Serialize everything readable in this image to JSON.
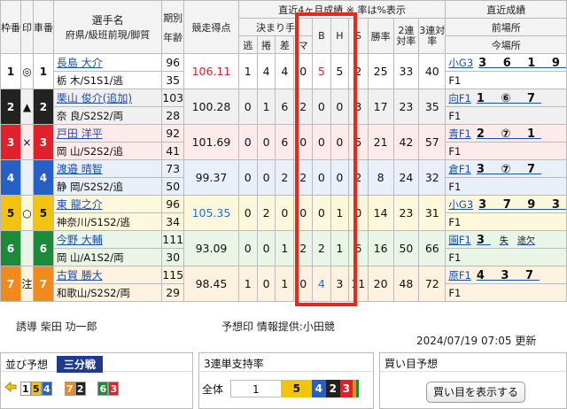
{
  "header": {
    "col_waku": "枠番",
    "col_mark": "印",
    "col_car": "車番",
    "col_name": "選手名",
    "col_name_sub": "府県/級班前現/脚質",
    "col_term": "期別",
    "col_age": "年齢",
    "col_score": "競走得点",
    "col_recent": "直近4ヶ月成績 ※ 率は%表示",
    "col_kimarite": "決まり手",
    "k_nige": "逃",
    "k_makuri": "捲",
    "k_sashi": "差",
    "k_mark": "マ",
    "col_b": "B",
    "col_h": "H",
    "col_s": "S",
    "col_win": "勝率",
    "col_win2": "2連対率",
    "col_win3": "3連対率",
    "col_last": "直近成績",
    "col_prev": "前場所",
    "col_now": "今場所"
  },
  "racers": [
    {
      "mark": "◎",
      "car": "1",
      "name": "長島 大介",
      "pref": "栃 木/S1S1/逃",
      "term": "96",
      "age": "35",
      "score": "106.11",
      "nige": "1",
      "makuri": "4",
      "sashi": "4",
      "mark_cnt": "0",
      "b": "5",
      "h": "5",
      "s": "2",
      "win": "25",
      "win2": "33",
      "win3": "40",
      "prev": "小G3",
      "prev_res": "3 6 1 9",
      "now": "F1",
      "now_res": ""
    },
    {
      "mark": "▲",
      "car": "2",
      "name": "栗山 俊介(追加)",
      "pref": "奈 良/S2S2/両",
      "term": "103",
      "age": "28",
      "score": "100.28",
      "nige": "0",
      "makuri": "1",
      "sashi": "6",
      "mark_cnt": "2",
      "b": "0",
      "h": "0",
      "s": "3",
      "win": "17",
      "win2": "23",
      "win3": "35",
      "prev": "向F1",
      "prev_res": "1 ⑥ 7",
      "now": "F1",
      "now_res": ""
    },
    {
      "mark": "×",
      "car": "3",
      "name": "戸田 洋平",
      "pref": "岡 山/S2S2/追",
      "term": "92",
      "age": "41",
      "score": "101.69",
      "nige": "0",
      "makuri": "0",
      "sashi": "6",
      "mark_cnt": "0",
      "b": "0",
      "h": "0",
      "s": "5",
      "win": "21",
      "win2": "42",
      "win3": "57",
      "prev": "青F1",
      "prev_res": "2 ⑦ 1",
      "now": "F1",
      "now_res": ""
    },
    {
      "mark": "",
      "car": "4",
      "name": "渡邉 晴智",
      "pref": "静 岡/S2S2/追",
      "term": "73",
      "age": "50",
      "score": "99.37",
      "nige": "0",
      "makuri": "0",
      "sashi": "2",
      "mark_cnt": "2",
      "b": "0",
      "h": "0",
      "s": "2",
      "win": "8",
      "win2": "24",
      "win3": "32",
      "prev": "倉F1",
      "prev_res": "3 ⑦ 7",
      "now": "F1",
      "now_res": ""
    },
    {
      "mark": "○",
      "car": "5",
      "name": "東 龍之介",
      "pref": "神奈川/S1S2/逃",
      "term": "96",
      "age": "34",
      "score": "105.35",
      "nige": "0",
      "makuri": "2",
      "sashi": "0",
      "mark_cnt": "0",
      "b": "0",
      "h": "1",
      "s": "0",
      "win": "14",
      "win2": "23",
      "win3": "31",
      "prev": "小G3",
      "prev_res": "3 7 9 3",
      "now": "F1",
      "now_res": ""
    },
    {
      "mark": "",
      "car": "6",
      "name": "今野 大輔",
      "pref": "岡 山/A1S2/両",
      "term": "111",
      "age": "30",
      "score": "93.09",
      "nige": "0",
      "makuri": "0",
      "sashi": "1",
      "mark_cnt": "2",
      "b": "2",
      "h": "1",
      "s": "6",
      "win": "16",
      "win2": "50",
      "win3": "66",
      "prev": "園F1",
      "prev_res": "3",
      "prev_res2": "失",
      "prev_res3": "途欠",
      "now": "F1",
      "now_res": ""
    },
    {
      "mark": "注",
      "car": "7",
      "name": "古賀 勝大",
      "pref": "和歌山/S2S2/両",
      "term": "115",
      "age": "29",
      "score": "98.45",
      "nige": "1",
      "makuri": "0",
      "sashi": "1",
      "mark_cnt": "0",
      "b": "4",
      "h": "3",
      "s": "11",
      "win": "20",
      "win2": "48",
      "win3": "72",
      "prev": "原F1",
      "prev_res": "4 3 7",
      "now": "F1",
      "now_res": ""
    }
  ],
  "footer": {
    "guide": "誘導  柴田 功一郎",
    "provider": "予想印 情報提供:小田競",
    "updated": "2024/07/19 07:05 更新"
  },
  "line_panel": {
    "title": "並び予想",
    "tab": "三分戦",
    "groups": [
      [
        "1",
        "5",
        "4"
      ],
      [
        "7",
        "2"
      ],
      [
        "6",
        "3"
      ]
    ]
  },
  "support_panel": {
    "title": "3連単支持率",
    "row_label": "全体",
    "segments": [
      "1",
      "5",
      "4",
      "2",
      "3"
    ]
  },
  "buy_panel": {
    "title": "買い目予想",
    "button": "買い目を表示する"
  },
  "colors": {
    "highlight": "#e42b1b",
    "link": "#1a4fb0",
    "score_top": "#d8262e",
    "score_second": "#2a6fd0"
  }
}
